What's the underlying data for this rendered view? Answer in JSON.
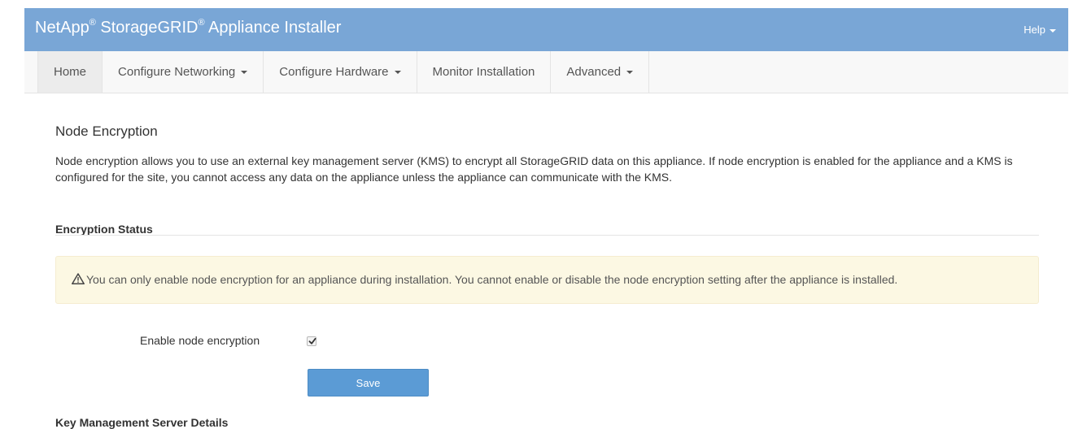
{
  "header": {
    "brand": "NetApp",
    "product": "StorageGRID",
    "registered_mark": "®",
    "app_suffix": " Appliance Installer",
    "help_label": "Help"
  },
  "nav": {
    "items": [
      {
        "label": "Home",
        "dropdown": false,
        "active": true
      },
      {
        "label": "Configure Networking",
        "dropdown": true
      },
      {
        "label": "Configure Hardware",
        "dropdown": true
      },
      {
        "label": "Monitor Installation",
        "dropdown": false
      },
      {
        "label": "Advanced",
        "dropdown": true
      }
    ]
  },
  "page": {
    "title": "Node Encryption",
    "intro": "Node encryption allows you to use an external key management server (KMS) to encrypt all StorageGRID data on this appliance. If node encryption is enabled for the appliance and a KMS is configured for the site, you cannot access any data on the appliance unless the appliance can communicate with the KMS."
  },
  "encryption_status": {
    "heading": "Encryption Status",
    "alert_text": "You can only enable node encryption for an appliance during installation. You cannot enable or disable the node encryption setting after the appliance is installed.",
    "alert_icon": "warning-triangle-icon",
    "enable_label": "Enable node encryption",
    "enable_checked": true,
    "save_label": "Save"
  },
  "kms": {
    "heading": "Key Management Server Details"
  },
  "colors": {
    "header_bg": "#79a6d6",
    "alert_bg": "#fcf8e3",
    "primary_button": "#5b9bd5"
  }
}
